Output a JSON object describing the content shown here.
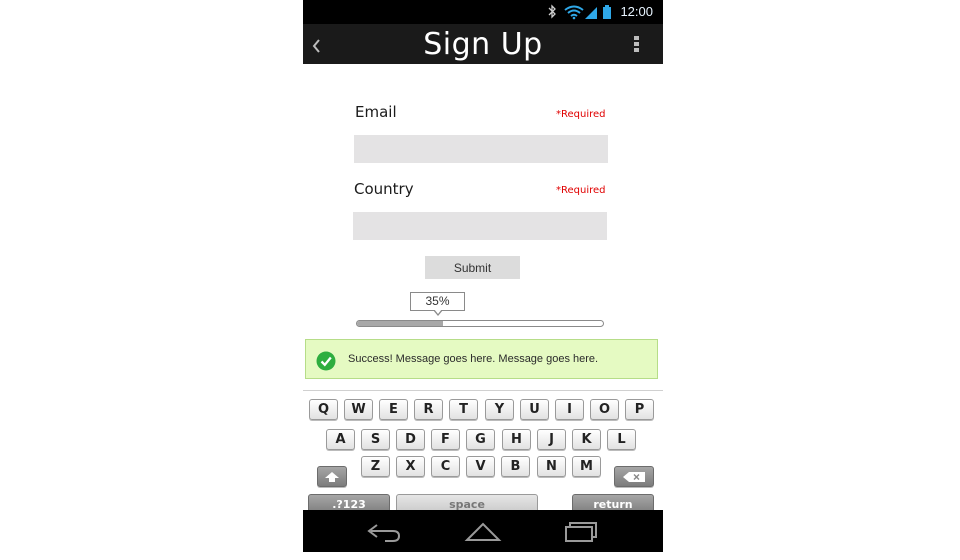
{
  "status_bar": {
    "time": "12:00",
    "icons": [
      "bluetooth-icon",
      "wifi-icon",
      "cell-signal-icon",
      "battery-icon"
    ]
  },
  "action_bar": {
    "title": "Sign Up",
    "back_icon": "chevron-left-icon",
    "overflow_icon": "overflow-menu-icon"
  },
  "form": {
    "email_label": "Email",
    "email_required": "*Required",
    "email_value": "",
    "country_label": "Country",
    "country_required": "*Required",
    "country_value": "",
    "submit_label": "Submit"
  },
  "progress": {
    "label": "35%",
    "value": 0.35
  },
  "success": {
    "message": "Success! Message goes here. Message goes here.",
    "icon": "checkmark-circle-icon",
    "color": "#e5fac2"
  },
  "keyboard": {
    "row1": [
      "Q",
      "W",
      "E",
      "R",
      "T",
      "Y",
      "U",
      "I",
      "O",
      "P"
    ],
    "row2": [
      "A",
      "S",
      "D",
      "F",
      "G",
      "H",
      "J",
      "K",
      "L"
    ],
    "row3": [
      "Z",
      "X",
      "C",
      "V",
      "B",
      "N",
      "M"
    ],
    "numbers_label": ".?123",
    "space_label": "space",
    "return_label": "return"
  },
  "nav_bar": {
    "icons": [
      "back-icon",
      "home-icon",
      "recents-icon"
    ]
  },
  "colors": {
    "required": "#e00000",
    "field_bg": "#e4e3e4",
    "action_bar": "#1a1a1a"
  }
}
